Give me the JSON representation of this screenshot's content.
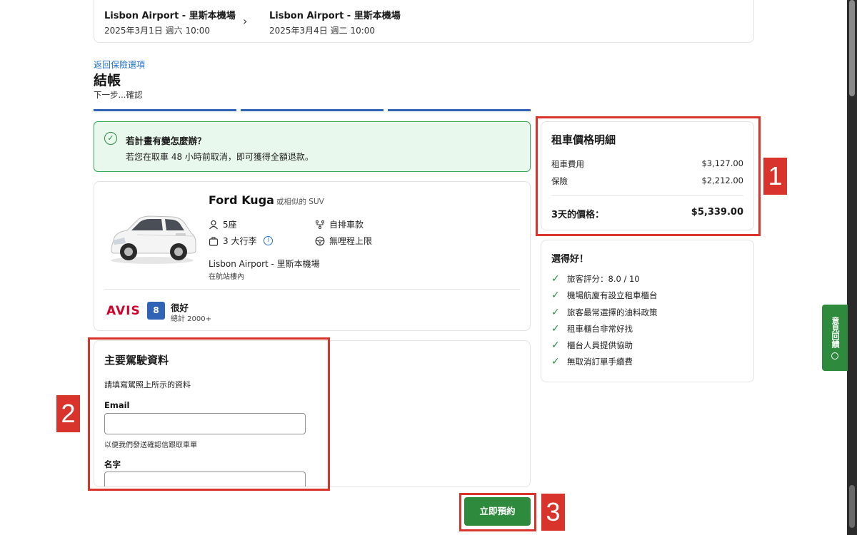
{
  "route": {
    "pickup": {
      "place": "Lisbon Airport - 里斯本機場",
      "time": "2025年3月1日 週六 10:00"
    },
    "dropoff": {
      "place": "Lisbon Airport - 里斯本機場",
      "time": "2025年3月4日 週二 10:00"
    },
    "arrow": "›"
  },
  "header": {
    "back_link": "返回保險選項",
    "title": "結帳",
    "next_step": "下一步...確認"
  },
  "notice": {
    "check": "✓",
    "title": "若計畫有變怎麼辦？",
    "body": "若您在取車 48 小時前取消，即可獲得全額退款。"
  },
  "car": {
    "name": "Ford Kuga",
    "similar": "或相似的 SUV",
    "seats": "5座",
    "transmission": "自排車款",
    "luggage": "3 大行李",
    "info": "i",
    "mileage": "無哩程上限",
    "pickup_location": "Lisbon Airport - 里斯本機場",
    "pickup_detail": "在航站樓內",
    "supplier": "AVIS",
    "rating_score": "8",
    "rating_label": "很好",
    "rating_count": "總計 2000+"
  },
  "driver": {
    "title": "主要駕駛資料",
    "subtitle": "請填寫駕照上所示的資料",
    "email_label": "Email",
    "email_value": "",
    "email_hint": "以便我們發送確認信跟取車單",
    "firstname_label": "名字",
    "firstname_value": ""
  },
  "price": {
    "title": "租車價格明細",
    "rows": [
      {
        "label": "租車費用",
        "amount": "$3,127.00"
      },
      {
        "label": "保險",
        "amount": "$2,212.00"
      }
    ],
    "total_label": "3天的價格：",
    "total_amount": "$5,339.00"
  },
  "good_choice": {
    "title": "選得好！",
    "tick": "✓",
    "items": [
      "旅客評分：8.0 / 10",
      "機場航廈有設立租車櫃台",
      "旅客最常選擇的油料政策",
      "租車櫃台非常好找",
      "櫃台人員提供協助",
      "無取消訂單手續費"
    ]
  },
  "feedback": {
    "label": "意見回饋"
  },
  "book_button": "立即預約",
  "annotations": [
    "1",
    "2",
    "3"
  ],
  "colors": {
    "accent_blue": "#2f63b5",
    "link_blue": "#1f6fd1",
    "brand_green": "#2e8b3e",
    "notice_bg": "#e9f8ec",
    "annotation_red": "#d9342b",
    "avis_red": "#d4002a"
  }
}
